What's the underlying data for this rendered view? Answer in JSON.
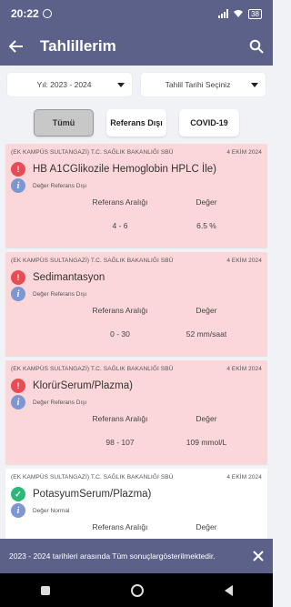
{
  "status_bar": {
    "time": "20:22",
    "battery": "38"
  },
  "app_bar": {
    "title": "Tahlillerim"
  },
  "filters": {
    "year": "Yıl: 2023 - 2024",
    "date": "Tahlil Tarihi Seçiniz"
  },
  "chips": [
    {
      "label": "Tümü",
      "active": true
    },
    {
      "label": "Referans Dışı",
      "active": false
    },
    {
      "label": "COVID-19",
      "active": false
    }
  ],
  "column_headers": {
    "reference": "Referans Aralığı",
    "value": "Değer"
  },
  "results": [
    {
      "hospital": "(EK KAMPÜS SULTANGAZİ) T.C. SAĞLIK BAKANLIĞI SBÜ",
      "date": "4 EKİM 2024",
      "test": "HB A1CGlikozile Hemoglobin HPLC İle)",
      "status": "Değer Referans Dışı",
      "range": "4 - 6",
      "value": "6.5 %"
    },
    {
      "hospital": "(EK KAMPÜS SULTANGAZİ) T.C. SAĞLIK BAKANLIĞI SBÜ",
      "date": "4 EKİM 2024",
      "test": "Sedimantasyon",
      "status": "Değer Referans Dışı",
      "range": "0 - 30",
      "value": "52 mm/saat"
    },
    {
      "hospital": "(EK KAMPÜS SULTANGAZİ) T.C. SAĞLIK BAKANLIĞI SBÜ",
      "date": "4 EKİM 2024",
      "test": "KlorürSerum/Plazma)",
      "status": "Değer Referans Dışı",
      "range": "98 - 107",
      "value": "109 mmol/L"
    },
    {
      "hospital": "(EK KAMPÜS SULTANGAZİ) T.C. SAĞLIK BAKANLIĞI SBÜ",
      "date": "4 EKİM 2024",
      "test": "PotasyumSerum/Plazma)",
      "status": "Değer Normal",
      "range": "",
      "value": ""
    }
  ],
  "snackbar": {
    "message": "2023 - 2024 tarihleri arasında Tüm sonuçlargösterilmektedir."
  },
  "colors": {
    "primary": "#5b6189",
    "out_of_range_bg": "#fcd7d9",
    "warning": "#e84d55",
    "normal": "#2db87a",
    "info": "#7c97d1"
  }
}
